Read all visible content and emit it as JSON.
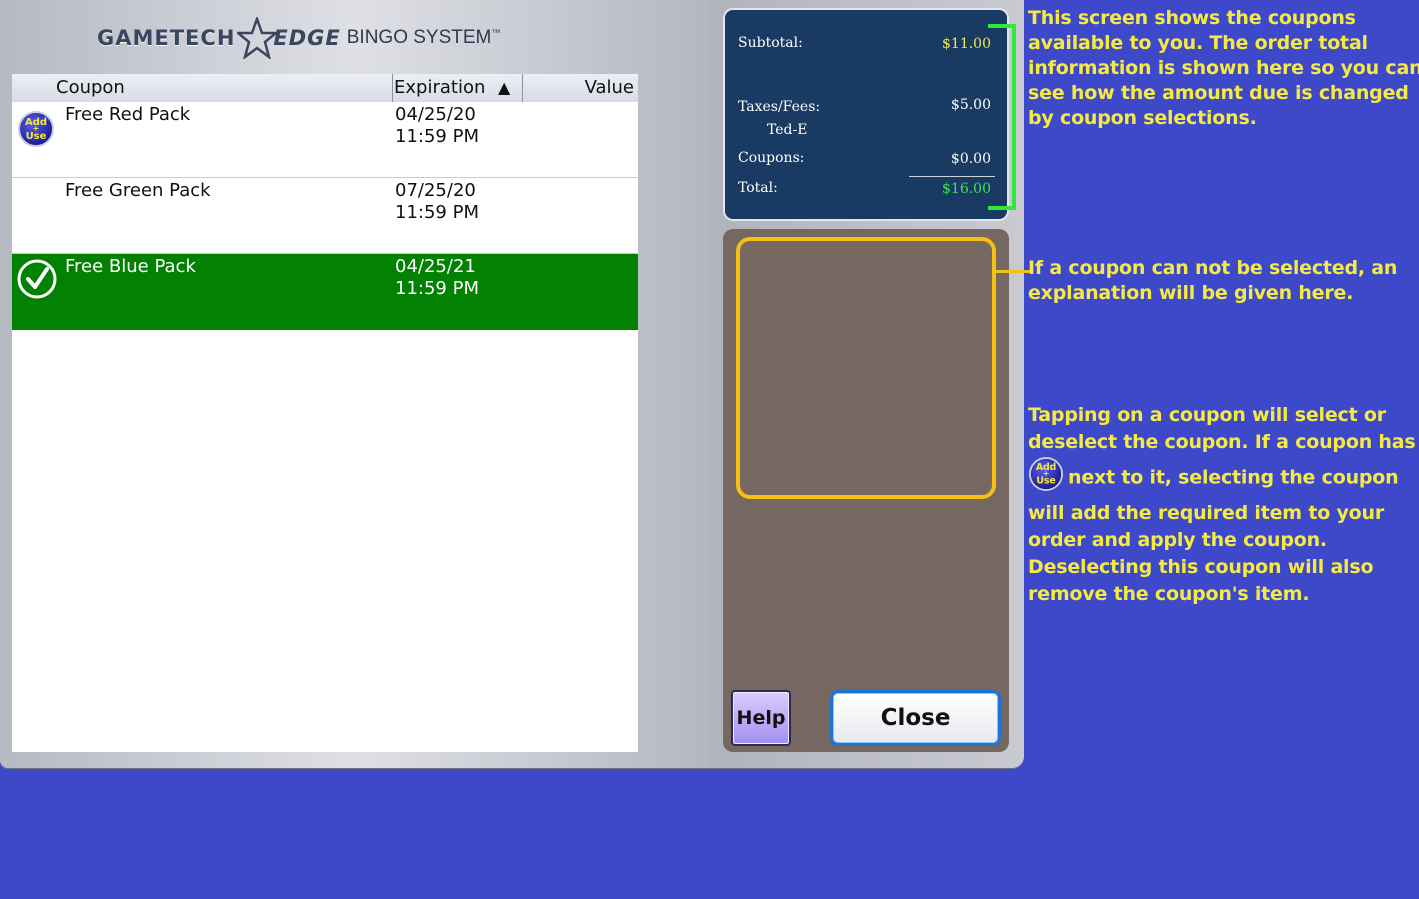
{
  "logo": {
    "part1": "GAMETECH",
    "part2": "EDGE",
    "part3": "BINGO SYSTEM",
    "tm": "™"
  },
  "table": {
    "headers": {
      "coupon": "Coupon",
      "expiration": "Expiration",
      "sort_indicator": "▲",
      "value": "Value"
    },
    "rows": [
      {
        "name": "Free Red Pack",
        "date": "04/25/20",
        "time": "11:59 PM",
        "value": "",
        "icon": "add-use-icon",
        "selected": false
      },
      {
        "name": "Free Green Pack",
        "date": "07/25/20",
        "time": "11:59 PM",
        "value": "",
        "icon": "",
        "selected": false
      },
      {
        "name": "Free Blue Pack",
        "date": "04/25/21",
        "time": "11:59 PM",
        "value": "",
        "icon": "checkmark-icon",
        "selected": true
      }
    ]
  },
  "summary": {
    "subtotal_label": "Subtotal:",
    "subtotal_value": "$11.00",
    "taxes_label": "Taxes/Fees:",
    "taxes_value": "$5.00",
    "tax_item": "Ted-E",
    "coupons_label": "Coupons:",
    "coupons_value": "$0.00",
    "total_label": "Total:",
    "total_value": "$16.00"
  },
  "buttons": {
    "help": "Help",
    "close": "Close"
  },
  "add_use_icon": {
    "line1": "Add",
    "line2": "+",
    "line3": "Use"
  },
  "annotations": {
    "note1": [
      " This screen shows the coupons",
      "available to you.  The order total",
      "information is shown here so you can",
      "see how the amount due is changed",
      "by coupon selections."
    ],
    "note2": [
      " If a coupon can not be selected, an",
      "explanation will be given here."
    ],
    "note3_lines": [
      " Tapping on a coupon will select or",
      "deselect the coupon.  If a coupon has"
    ],
    "note3_icon_suffix": "next to it, selecting the coupon",
    "note3_rest": [
      "will add the required item to your",
      "order and apply the coupon.",
      "Deselecting this coupon will also",
      "remove the coupon's item."
    ]
  },
  "colors": {
    "background": "#3e49c9",
    "selected_row": "#028102",
    "summary_bg": "#193a62",
    "annotation_text": "#f4ea41",
    "bracket_green": "#2ee83a",
    "message_border": "#f6bf14"
  }
}
